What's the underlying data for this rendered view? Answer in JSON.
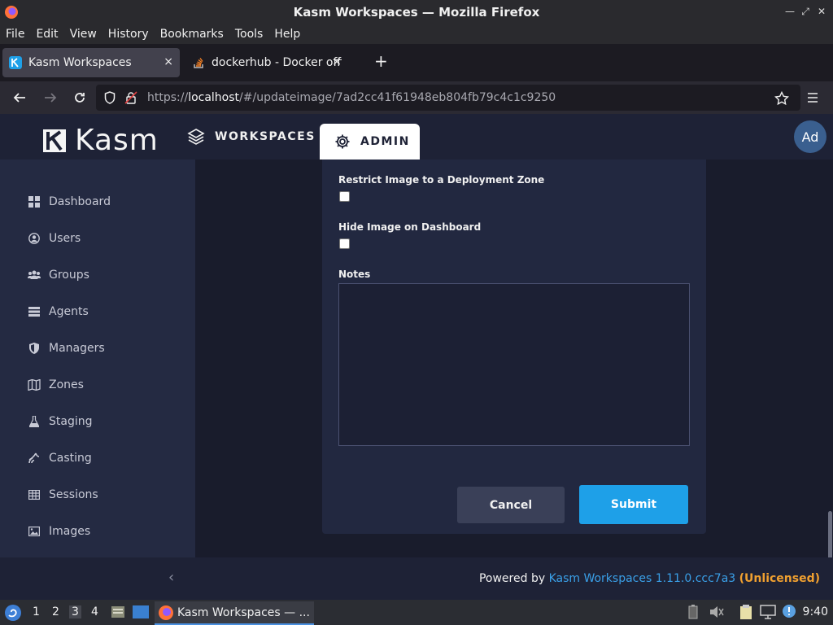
{
  "window": {
    "title": "Kasm Workspaces — Mozilla Firefox",
    "controls": [
      "✕",
      "⤢",
      "—"
    ]
  },
  "menubar": [
    "File",
    "Edit",
    "View",
    "History",
    "Bookmarks",
    "Tools",
    "Help"
  ],
  "tabs": [
    {
      "label": "Kasm Workspaces",
      "close": "×",
      "icon": "kasm-favicon"
    },
    {
      "label": "dockerhub - Docker offici",
      "close": "×",
      "icon": "stackoverflow-favicon"
    }
  ],
  "newtab": "+",
  "url": {
    "prefix": "https://",
    "host": "localhost",
    "path": "/#/updateimage/7ad2cc41f61948eb804fb79c4c1c9250"
  },
  "app": {
    "brand": "Kasm",
    "nav": {
      "workspaces": "WORKSPACES",
      "admin": "ADMIN"
    },
    "avatar": "Ad"
  },
  "sidebar": {
    "items": [
      {
        "label": "Dashboard",
        "icon": "grid-icon"
      },
      {
        "label": "Users",
        "icon": "user-circle-icon"
      },
      {
        "label": "Groups",
        "icon": "users-icon"
      },
      {
        "label": "Agents",
        "icon": "server-icon"
      },
      {
        "label": "Managers",
        "icon": "shield-icon"
      },
      {
        "label": "Zones",
        "icon": "map-icon"
      },
      {
        "label": "Staging",
        "icon": "flask-icon"
      },
      {
        "label": "Casting",
        "icon": "cast-icon"
      },
      {
        "label": "Sessions",
        "icon": "table-icon"
      },
      {
        "label": "Images",
        "icon": "image-icon"
      }
    ]
  },
  "form": {
    "restrict_label": "Restrict Image to a Deployment Zone",
    "hide_label": "Hide Image on Dashboard",
    "notes_label": "Notes",
    "notes_value": "",
    "cancel": "Cancel",
    "submit": "Submit"
  },
  "footer": {
    "powered_by": "Powered by ",
    "version": "Kasm Workspaces 1.11.0.ccc7a3",
    "license": "(Unlicensed)"
  },
  "taskbar": {
    "workspaces": [
      "1",
      "2",
      "3",
      "4"
    ],
    "active_workspace": "3",
    "app_label": "Kasm Workspaces — ...",
    "clock": "9:40"
  },
  "colors": {
    "accent": "#1ea0e8",
    "warning": "#f0a030",
    "header_bg": "#1e2236"
  }
}
